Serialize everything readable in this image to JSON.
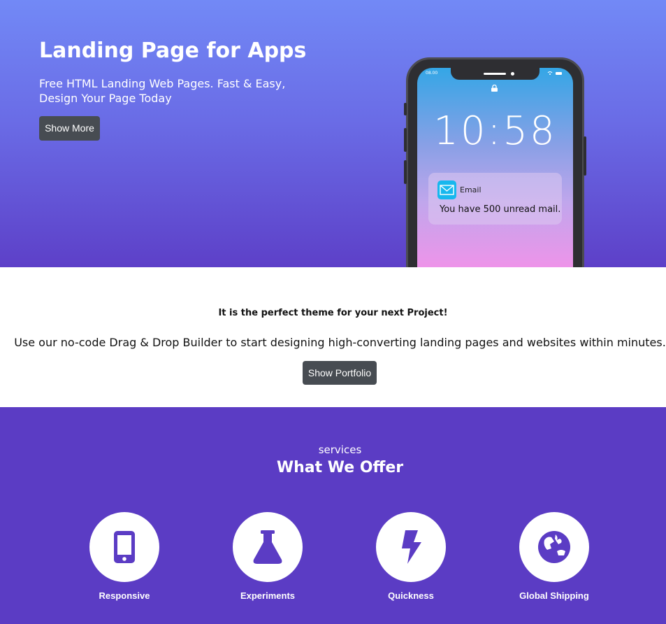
{
  "hero": {
    "title": "Landing Page for Apps",
    "subtitle": "Free HTML Landing Web Pages. Fast & Easy, Design Your Page Today",
    "button_label": "Show More"
  },
  "phone": {
    "status_time": "08.00",
    "clock": "10:58",
    "notification": {
      "app": "Email",
      "message": "You have 500 unread mail."
    }
  },
  "intro": {
    "tagline": "It is the perfect theme for your next Project!",
    "text": "Use our no-code Drag & Drop Builder to start designing high-converting landing pages and websites within minutes.",
    "button_label": "Show Portfolio"
  },
  "services": {
    "kicker": "services",
    "title": "What We Offer",
    "items": [
      {
        "label": "Responsive",
        "icon": "mobile-icon"
      },
      {
        "label": "Experiments",
        "icon": "flask-icon"
      },
      {
        "label": "Quickness",
        "icon": "bolt-icon"
      },
      {
        "label": "Global Shipping",
        "icon": "globe-icon"
      }
    ]
  },
  "colors": {
    "accent_purple": "#5b3cc4",
    "hero_top": "#7289f6",
    "button_dark": "#474c52",
    "notification_icon": "#17b7ee"
  }
}
